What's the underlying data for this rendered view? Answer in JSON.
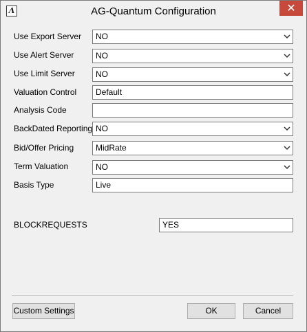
{
  "window": {
    "title": "AG-Quantum Configuration",
    "icon_glyph": "Λ",
    "close_glyph": "✕"
  },
  "fields": [
    {
      "label": "Use Export Server",
      "type": "select",
      "value": "NO"
    },
    {
      "label": "Use Alert Server",
      "type": "select",
      "value": "NO"
    },
    {
      "label": "Use Limit Server",
      "type": "select",
      "value": "NO"
    },
    {
      "label": "Valuation Control",
      "type": "text",
      "value": "Default"
    },
    {
      "label": "Analysis Code",
      "type": "text",
      "value": ""
    },
    {
      "label": "BackDated Reporting",
      "type": "select",
      "value": "NO"
    },
    {
      "label": "Bid/Offer Pricing",
      "type": "select",
      "value": "MidRate"
    },
    {
      "label": "Term Valuation",
      "type": "select",
      "value": "NO"
    },
    {
      "label": "Basis Type",
      "type": "text",
      "value": "Live"
    }
  ],
  "block": {
    "label": "BLOCKREQUESTS",
    "value": "YES"
  },
  "buttons": {
    "custom_settings": "Custom Settings",
    "ok": "OK",
    "cancel": "Cancel"
  },
  "colors": {
    "close_button": "#c7493b",
    "dialog_background": "#f0f0f0"
  }
}
